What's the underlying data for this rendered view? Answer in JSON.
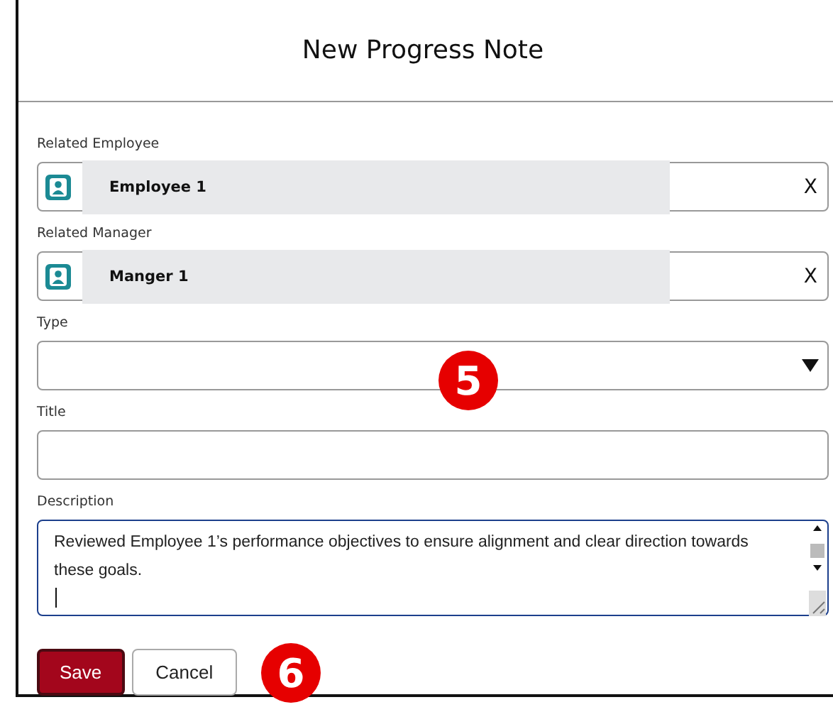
{
  "dialog": {
    "title": "New Progress Note"
  },
  "fields": [
    {
      "kind": "lookup",
      "label": "Related Employee",
      "value": "Employee 1",
      "clear": "X"
    },
    {
      "kind": "lookup",
      "label": "Related Manager",
      "value": "Manger 1",
      "clear": "X"
    },
    {
      "kind": "select",
      "label": "Type"
    },
    {
      "kind": "text",
      "label": "Title"
    },
    {
      "kind": "textarea",
      "label": "Description",
      "value": "Reviewed Employee 1’s performance objectives to ensure alignment and clear direction towards these goals.",
      "focused": true
    }
  ],
  "buttons": [
    {
      "kind": "primary",
      "label": "Save"
    },
    {
      "kind": "secondary",
      "label": "Cancel"
    }
  ],
  "annotations": [
    {
      "text": "5"
    },
    {
      "text": "6"
    }
  ]
}
